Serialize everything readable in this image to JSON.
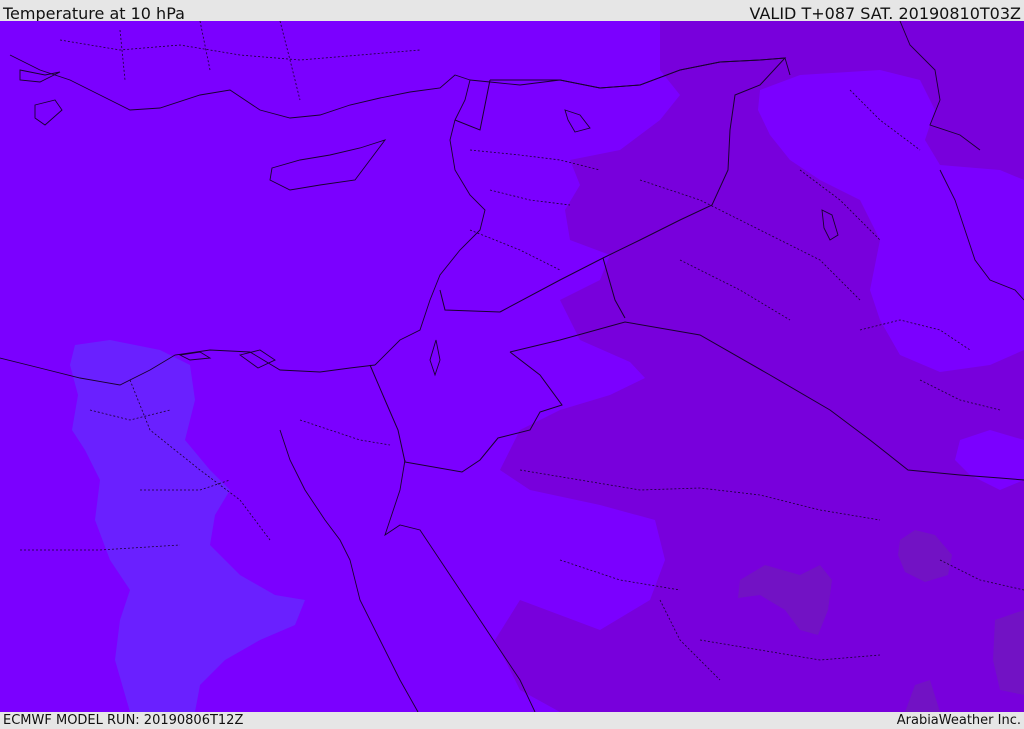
{
  "header": {
    "title": "Temperature at 10 hPa",
    "valid": "VALID T+087 SAT. 20190810T03Z"
  },
  "footer": {
    "model_run": "ECMWF MODEL RUN: 20190806T12Z",
    "credit": "ArabiaWeather Inc."
  },
  "colors": {
    "base_violet": "#7b00ff",
    "dark_violet": "#7800dc",
    "blue_violet": "#6a20ff",
    "deep_purple": "#7212c4",
    "border": "#1a0030"
  }
}
